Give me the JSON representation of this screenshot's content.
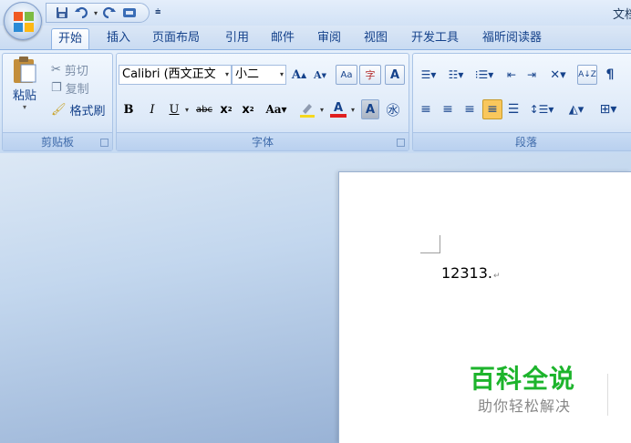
{
  "window": {
    "title": "文档"
  },
  "quick_access": [
    "save-icon",
    "undo-icon",
    "redo-icon",
    "print-preview-icon"
  ],
  "tabs": [
    "开始",
    "插入",
    "页面布局",
    "引用",
    "邮件",
    "审阅",
    "视图",
    "开发工具",
    "福昕阅读器"
  ],
  "active_tab": 0,
  "ribbon": {
    "clipboard": {
      "paste": "粘贴",
      "cut": "剪切",
      "copy": "复制",
      "format_painter": "格式刷",
      "label": "剪贴板"
    },
    "font": {
      "family": "Calibri (西文正文",
      "size": "小二",
      "label": "字体"
    },
    "paragraph": {
      "label": "段落"
    }
  },
  "document": {
    "text": "12313."
  },
  "watermark": {
    "brand": "百科全说",
    "slogan": "助你轻松解决"
  },
  "colors": {
    "accent": "#15428b",
    "highlight": "#f5d81e",
    "font_color": "#e01f1f",
    "brand_green": "#1db42c"
  }
}
